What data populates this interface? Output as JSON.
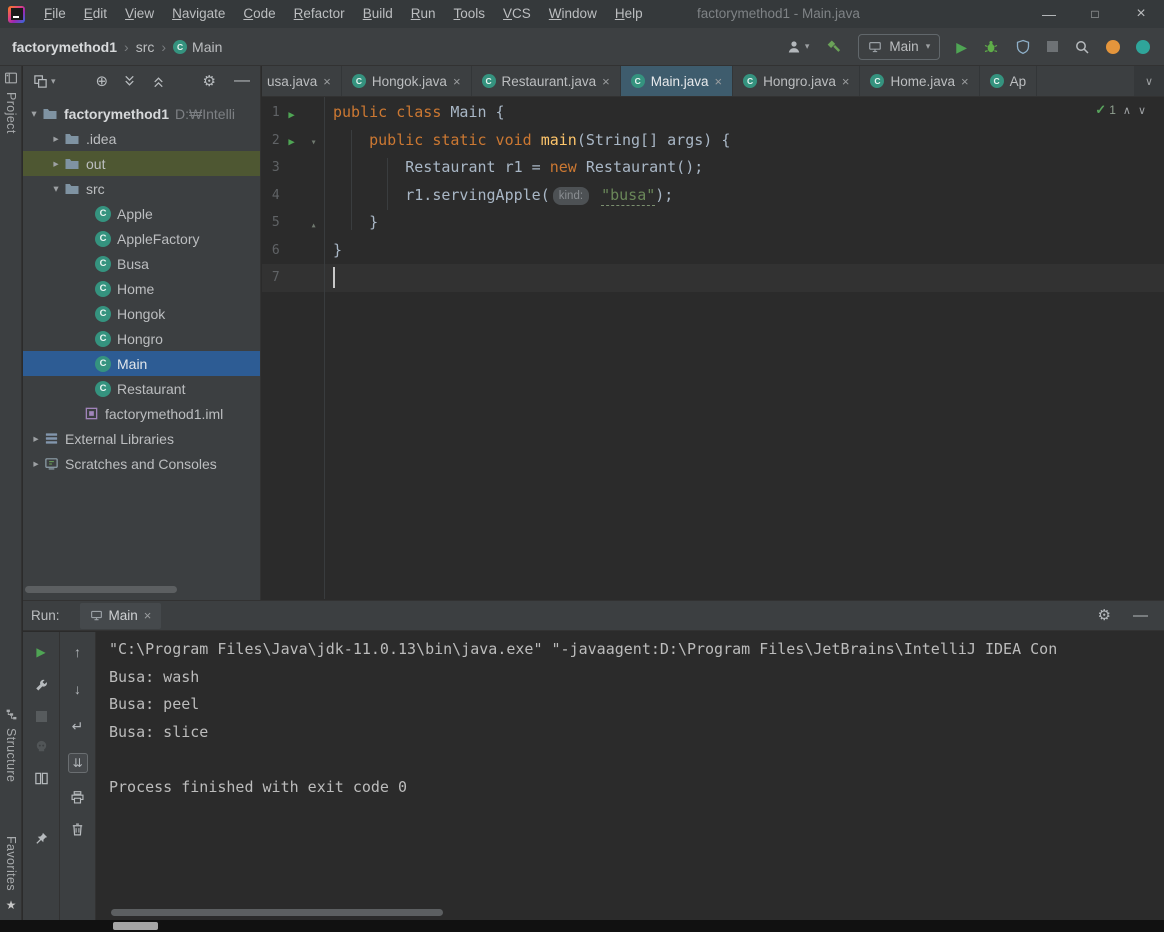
{
  "icons": {
    "minimize": "—",
    "maximize": "□",
    "close": "×",
    "crumb_sep": "›",
    "chev_down": "▾",
    "chev_right": "▸",
    "tab_close": "×",
    "overflow_chevron": "∨",
    "gear": "⚙",
    "locate": "⊕",
    "play": "▶",
    "up_arrow": "↑",
    "down_arrow": "↓",
    "soft_wrap": "↵",
    "scroll_to_end": "⇊",
    "check": "✓",
    "chev_up_small": "∧",
    "chev_down_small": "∨",
    "fold_start": "▾",
    "fold_end": "▴",
    "star": "★"
  },
  "titlebar": {
    "title": "factorymethod1 - Main.java",
    "menus": [
      "File",
      "Edit",
      "View",
      "Navigate",
      "Code",
      "Refactor",
      "Build",
      "Run",
      "Tools",
      "VCS",
      "Window",
      "Help"
    ]
  },
  "navbar": {
    "crumbs": {
      "project": "factorymethod1",
      "folder": "src",
      "file": "Main"
    },
    "run_config": "Main"
  },
  "editor": {
    "tabs": [
      {
        "label": "usa.java"
      },
      {
        "label": "Hongok.java"
      },
      {
        "label": "Restaurant.java"
      },
      {
        "label": "Main.java"
      },
      {
        "label": "Hongro.java"
      },
      {
        "label": "Home.java"
      },
      {
        "label": "Ap"
      }
    ],
    "inspection_count": "1",
    "lines": [
      {
        "num": "1",
        "t0": "public class ",
        "t1": "Main {"
      },
      {
        "num": "2",
        "t0": "    ",
        "t1": "public static void ",
        "t2": "main",
        "t3": "(String[] args) {"
      },
      {
        "num": "3",
        "t0": "        Restaurant r1 = ",
        "t1": "new ",
        "t2": "Restaurant();"
      },
      {
        "num": "4",
        "t0": "        r1.servingApple(",
        "hint": "kind:",
        "t1": " ",
        "t2": "\"busa\"",
        "t3": ");"
      },
      {
        "num": "5",
        "t0": "    }"
      },
      {
        "num": "6",
        "t0": "}"
      },
      {
        "num": "7",
        "t0": ""
      }
    ]
  },
  "project": {
    "tree": [
      {
        "label": "factorymethod1",
        "hint": "D:₩Intelli"
      },
      {
        "label": ".idea"
      },
      {
        "label": "out"
      },
      {
        "label": "src"
      },
      {
        "label": "Apple"
      },
      {
        "label": "AppleFactory"
      },
      {
        "label": "Busa"
      },
      {
        "label": "Home"
      },
      {
        "label": "Hongok"
      },
      {
        "label": "Hongro"
      },
      {
        "label": "Main"
      },
      {
        "label": "Restaurant"
      },
      {
        "label": "factorymethod1.iml"
      },
      {
        "label": "External Libraries"
      },
      {
        "label": "Scratches and Consoles"
      }
    ]
  },
  "tool_windows": {
    "project": "Project",
    "structure": "Structure",
    "favorites": "Favorites"
  },
  "run": {
    "label": "Run:",
    "tab": "Main",
    "console": [
      "\"C:\\Program Files\\Java\\jdk-11.0.13\\bin\\java.exe\" \"-javaagent:D:\\Program Files\\JetBrains\\IntelliJ IDEA Con",
      "Busa: wash",
      "Busa: peel",
      "Busa: slice",
      "",
      "Process finished with exit code 0"
    ]
  },
  "colors": {
    "selection_blue": "#2d5c94",
    "out_highlight_olive": "#4e5732",
    "active_tab_blue": "#3e5c6d",
    "keyword_orange": "#cc7832",
    "method_yellow": "#ffc66b",
    "string_green": "#6a8759",
    "run_green": "#4fa554",
    "editor_bg": "#2b2b2b",
    "panel_bg": "#3c3f41"
  }
}
